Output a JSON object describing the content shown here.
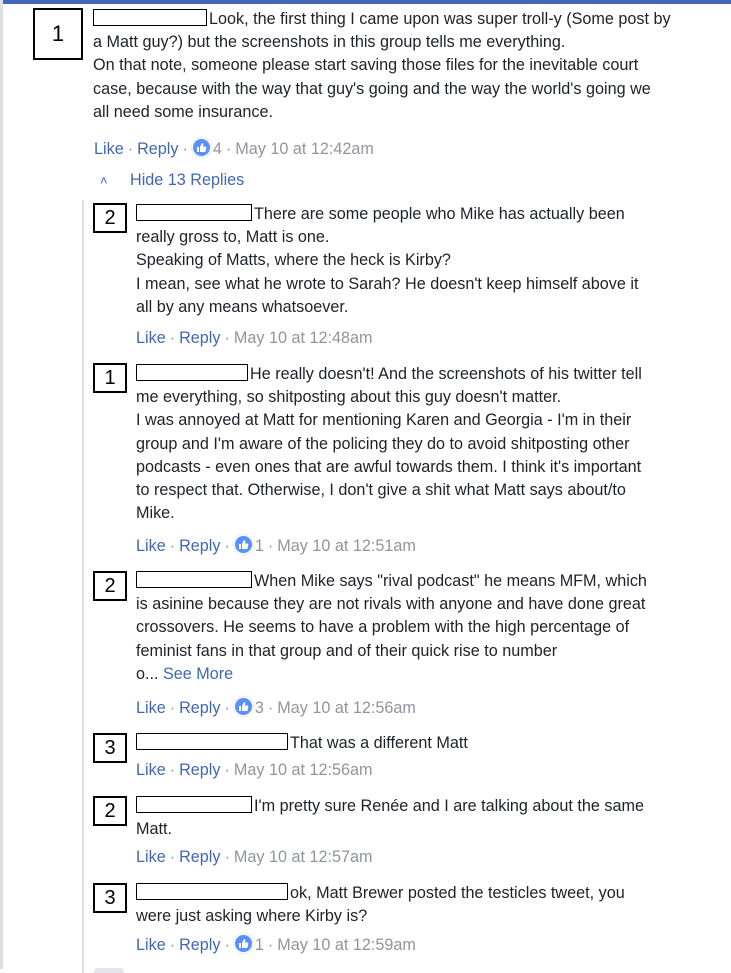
{
  "comments": [
    {
      "label": "1",
      "text_lines": [
        "Look, the first thing I came upon was super troll-y (Some post by",
        "a Matt guy?) but the screenshots in this group tells me everything.",
        "On that note, someone please start saving those files for the inevitable court",
        "case, because with the way that guy's going and the way the world's going we",
        "all need some insurance."
      ],
      "like": "Like",
      "reply": "Reply",
      "likes_count": "4",
      "timestamp": "May 10 at 12:42am"
    }
  ],
  "hide_replies": "Hide 13 Replies",
  "replies": [
    {
      "label": "2",
      "text_lines": [
        "There are some people who Mike has actually been",
        "really gross to, Matt is one.",
        "Speaking of Matts, where the heck is Kirby?",
        "I mean, see what he wrote to Sarah? He doesn't keep himself above it",
        "all by any means whatsoever."
      ],
      "like": "Like",
      "reply": "Reply",
      "likes_count": "",
      "timestamp": "May 10 at 12:48am"
    },
    {
      "label": "1",
      "text_lines": [
        "He really doesn't! And the screenshots of his twitter tell",
        "me everything, so shitposting about this guy doesn't matter.",
        "I was annoyed at Matt for mentioning Karen and Georgia - I'm in their",
        "group and I'm aware of the policing they do to avoid shitposting other",
        "podcasts - even ones that are awful towards them. I think it's important",
        "to respect that. Otherwise, I don't give a shit what Matt says about/to",
        "Mike."
      ],
      "like": "Like",
      "reply": "Reply",
      "likes_count": "1",
      "timestamp": "May 10 at 12:51am"
    },
    {
      "label": "2",
      "text_lines": [
        "When Mike says \"rival podcast\" he means MFM, which",
        "is asinine because they are not rivals with anyone and have done great",
        "crossovers. He seems to have a problem with the high percentage of",
        "feminist fans in that group and of their quick rise to number",
        "o..."
      ],
      "see_more": "See More",
      "like": "Like",
      "reply": "Reply",
      "likes_count": "3",
      "timestamp": "May 10 at 12:56am"
    },
    {
      "label": "3",
      "text_lines": [
        "That was a different Matt"
      ],
      "like": "Like",
      "reply": "Reply",
      "likes_count": "",
      "timestamp": "May 10 at 12:56am"
    },
    {
      "label": "2",
      "text_lines": [
        "I'm pretty sure Renée and I are talking about the same",
        "Matt."
      ],
      "like": "Like",
      "reply": "Reply",
      "likes_count": "",
      "timestamp": "May 10 at 12:57am"
    },
    {
      "label": "3",
      "text_lines": [
        "ok, Matt Brewer posted the testicles tweet, you",
        "were just asking where Kirby is?"
      ],
      "like": "Like",
      "reply": "Reply",
      "likes_count": "1",
      "timestamp": "May 10 at 12:59am"
    }
  ],
  "colors": {
    "link": "#4267b2",
    "meta": "#90949c",
    "text": "#1d2129",
    "like_badge": "#5890ff"
  },
  "icons": {
    "like_badge": "thumbs-up-icon",
    "hide_replies": "chevron-up-icon"
  }
}
